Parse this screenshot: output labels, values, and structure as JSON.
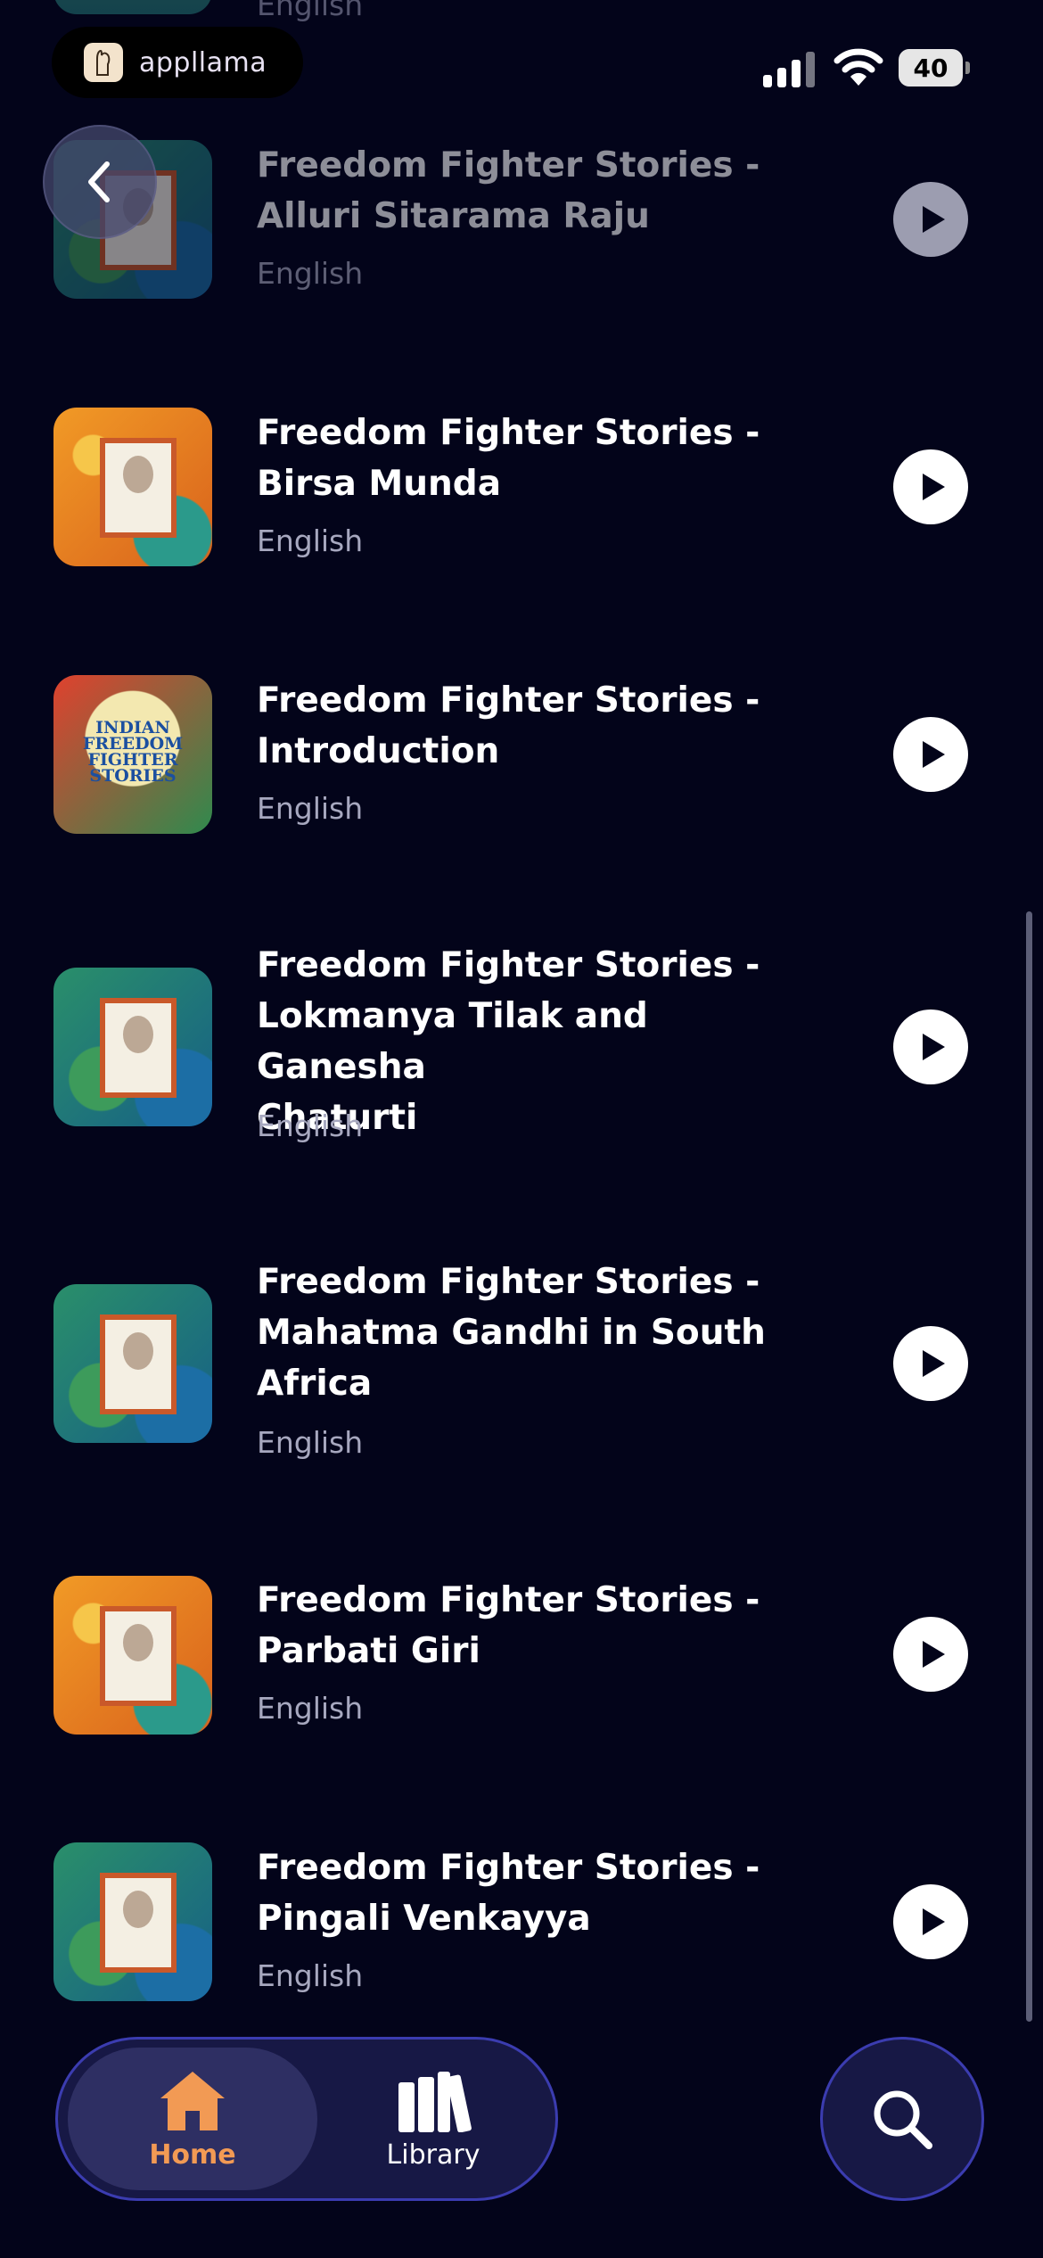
{
  "status_bar": {
    "app_name": "appllama",
    "battery_level": "40"
  },
  "partial_row": {
    "language": "English"
  },
  "items": [
    {
      "title": "Freedom Fighter Stories -\nAlluri Sitarama Raju",
      "language": "English",
      "art": "green"
    },
    {
      "title": "Freedom Fighter Stories -\nBirsa Munda",
      "language": "English",
      "art": "orange"
    },
    {
      "title": "Freedom Fighter Stories -\nIntroduction",
      "language": "English",
      "art": "intro",
      "art_text": "INDIAN FREEDOM FIGHTER STORIES"
    },
    {
      "title": "Freedom Fighter Stories -\nLokmanya Tilak and Ganesha\nChaturti",
      "language": "English",
      "art": "green"
    },
    {
      "title": "Freedom Fighter Stories -\nMahatma Gandhi in South\nAfrica",
      "language": "English",
      "art": "green"
    },
    {
      "title": "Freedom Fighter Stories -\nParbati Giri",
      "language": "English",
      "art": "orange"
    },
    {
      "title": "Freedom Fighter Stories -\nPingali Venkayya",
      "language": "English",
      "art": "green"
    }
  ],
  "tabbar": {
    "home_label": "Home",
    "library_label": "Library",
    "active": "home"
  },
  "colors": {
    "background": "#03041a",
    "accent": "#f29a54",
    "tab_border": "#3b3cb0"
  }
}
